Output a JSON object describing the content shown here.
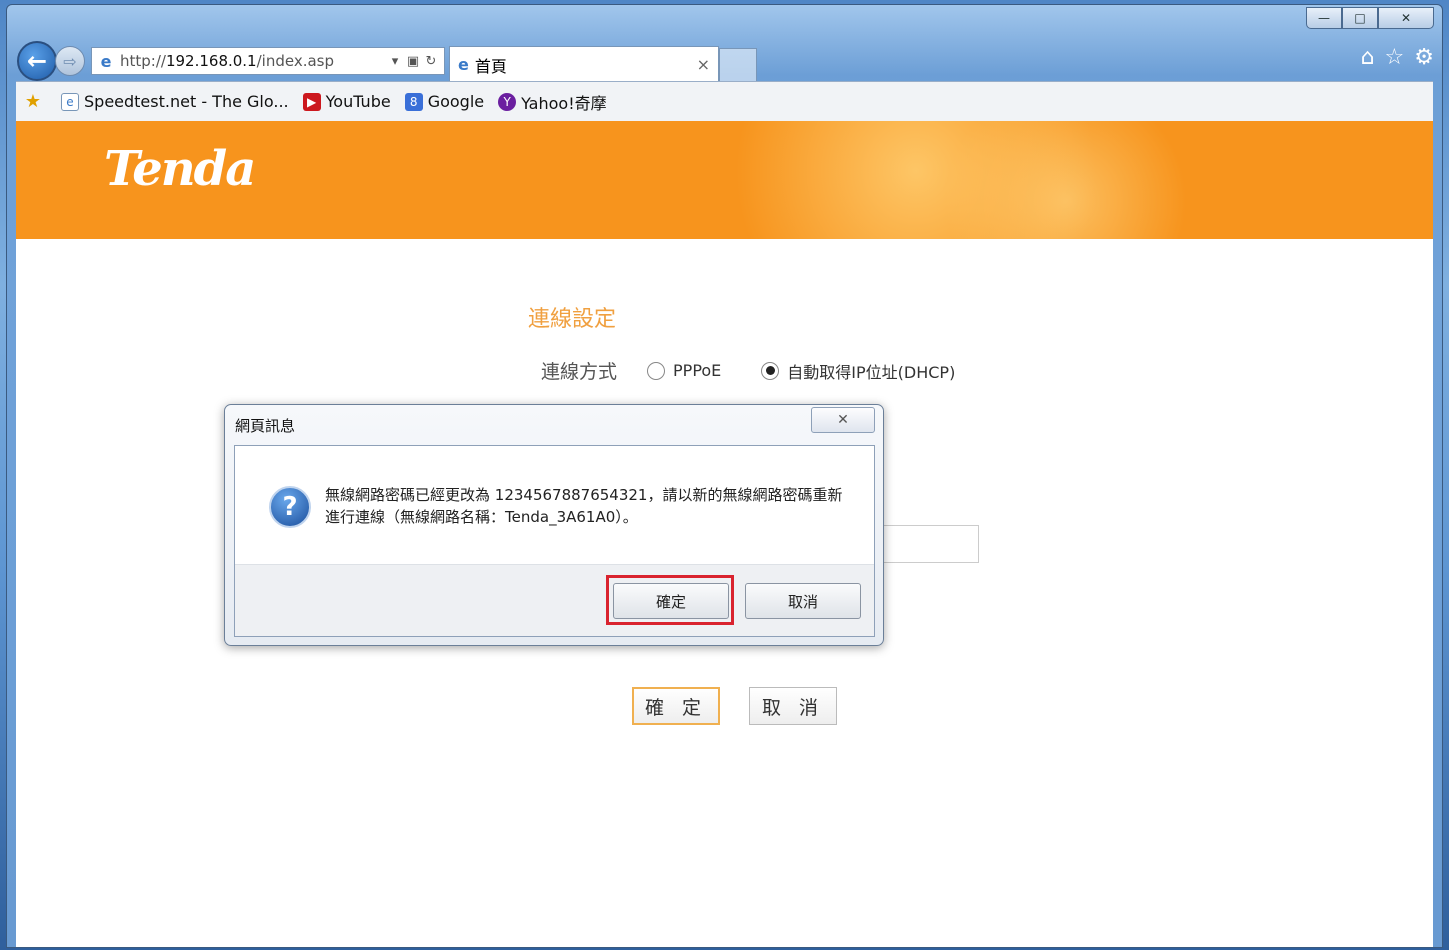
{
  "browser": {
    "address": {
      "url_prefix": "http://",
      "url_host": "192.168.0.1",
      "url_path": "/index.asp"
    },
    "tab": {
      "title": "首頁",
      "close_glyph": "×"
    },
    "window_controls": {
      "minimize": "—",
      "maximize": "□",
      "close": "✕"
    },
    "right_icons": [
      "home-icon",
      "star-icon",
      "gear-icon"
    ]
  },
  "favorites": {
    "items": [
      {
        "label": "Speedtest.net - The Glo...",
        "icon": "ie-page-icon"
      },
      {
        "label": "YouTube",
        "icon": "youtube-icon",
        "color": "#cc181e"
      },
      {
        "label": "Google",
        "icon": "google-icon",
        "color": "#3a6fd8"
      },
      {
        "label": "Yahoo!奇摩",
        "icon": "yahoo-icon",
        "color": "#6b1fa0"
      }
    ]
  },
  "page": {
    "logo": "Tenda",
    "accent_color": "#f7941d",
    "section_title": "連線設定",
    "conn_label": "連線方式",
    "radio_options": [
      {
        "label": "PPPoE",
        "checked": false
      },
      {
        "label": "自動取得IP位址(DHCP)",
        "checked": true
      }
    ],
    "ok_button": "確 定",
    "cancel_button": "取 消"
  },
  "dialog": {
    "title": "網頁訊息",
    "message": "無線網路密碼已經更改為 1234567887654321，請以新的無線網路密碼重新進行連線（無線網路名稱：Tenda_3A61A0）。",
    "ok_button": "確定",
    "cancel_button": "取消",
    "highlight_color": "#d9232e"
  }
}
